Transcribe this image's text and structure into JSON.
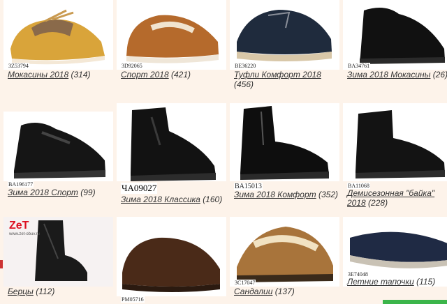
{
  "products": [
    {
      "code": "3Z53794",
      "name": "Мокасины 2018",
      "count": "(314)",
      "color": "#d9a43a"
    },
    {
      "code": "3D92065",
      "name": "Спорт 2018",
      "count": "(421)",
      "color": "#b56a2c"
    },
    {
      "code": "BE36220",
      "name": "Туфли Комфорт 2018",
      "count": "(456)",
      "color": "#1f2b3d"
    },
    {
      "code": "BA34761",
      "name": "Зима 2018 Мокасины",
      "count": "(26)",
      "color": "#111111"
    },
    {
      "code": "BA196177",
      "name": "Зима 2018 Спорт",
      "count": "(99)",
      "color": "#151515"
    },
    {
      "code": "ЧА09027",
      "name": "Зима 2018 Классика",
      "count": "(160)",
      "color": "#121212"
    },
    {
      "code": "BA15013",
      "name": "Зима 2018 Комфорт",
      "count": "(352)",
      "color": "#0e0e0e"
    },
    {
      "code": "BA11068",
      "name": "Демисезонная \"байка\" 2018",
      "count": "(228)",
      "color": "#131313"
    },
    {
      "code": "",
      "name": "Берцы",
      "count": "(112)",
      "color": "#1a1a1a"
    },
    {
      "code": "PM05716",
      "name": "",
      "count": "",
      "color": "#4a2a18"
    },
    {
      "code": "3C17047",
      "name": "Сандалии",
      "count": "(137)",
      "color": "#a8743b"
    },
    {
      "code": "3E74048",
      "name": "Летние тапочки",
      "count": "(115)",
      "color": "#1f2a44"
    }
  ],
  "watermark": {
    "brand": "ZeT",
    "site": "www.zet-obuv.ru"
  }
}
